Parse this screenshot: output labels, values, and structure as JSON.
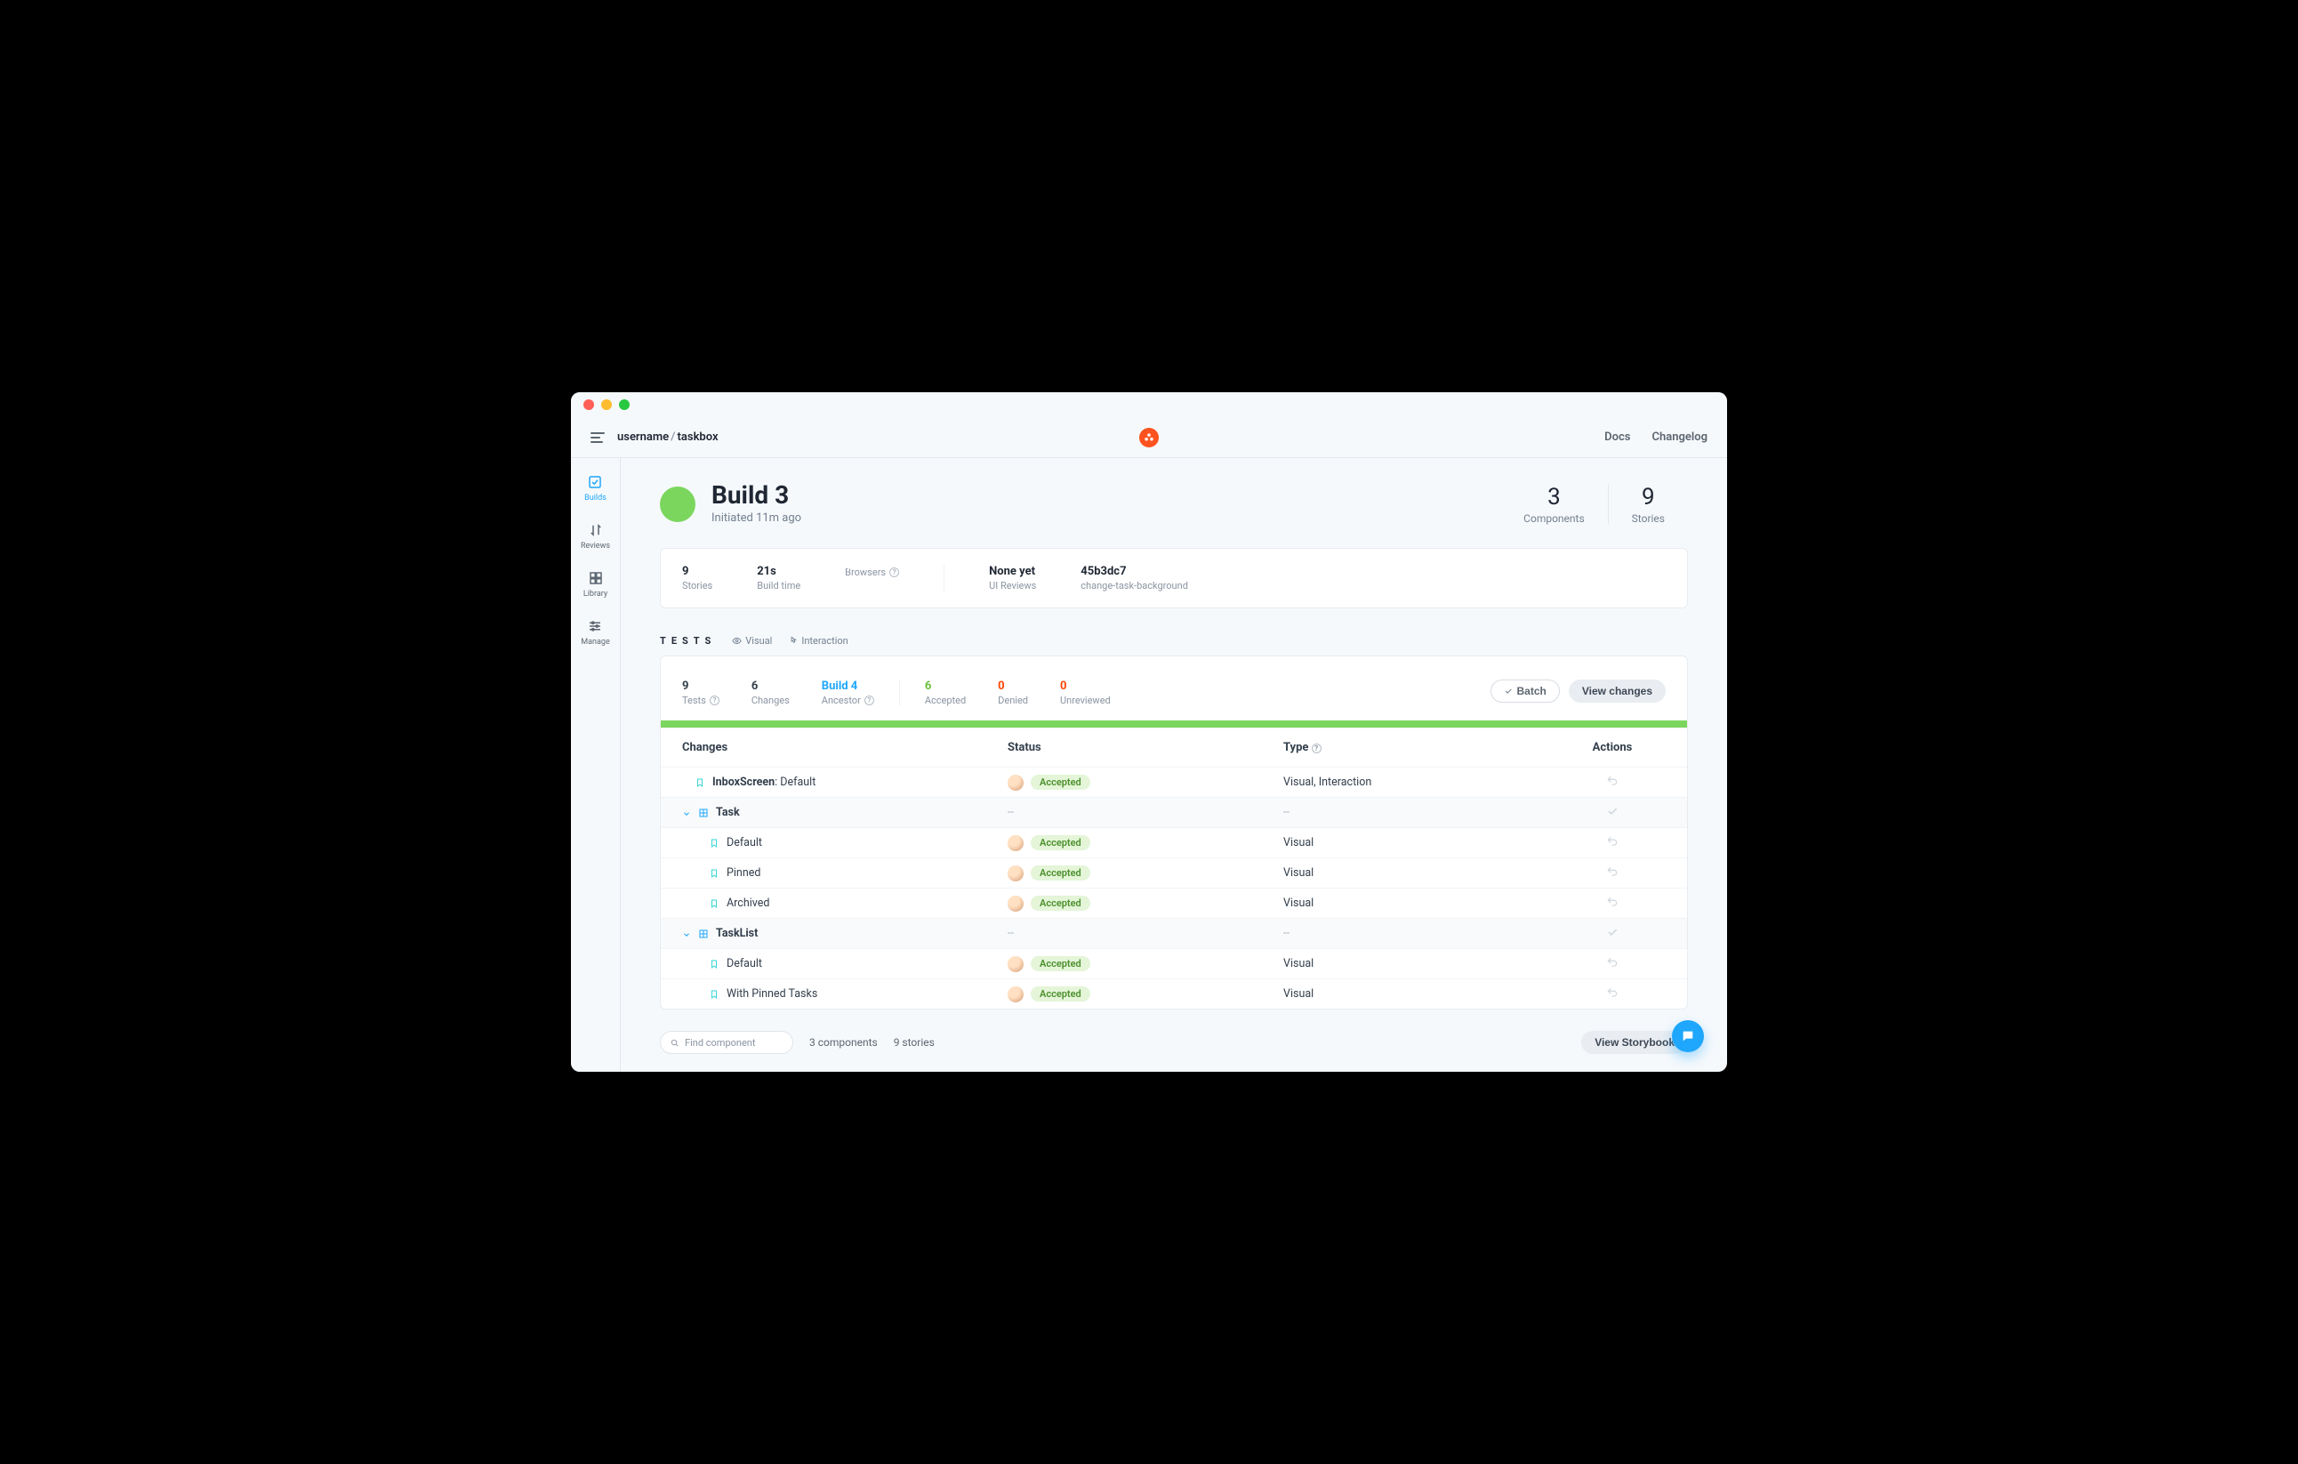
{
  "breadcrumb": {
    "owner": "username",
    "repo": "taskbox"
  },
  "top_nav": {
    "docs": "Docs",
    "changelog": "Changelog"
  },
  "sidebar": {
    "items": [
      {
        "label": "Builds"
      },
      {
        "label": "Reviews"
      },
      {
        "label": "Library"
      },
      {
        "label": "Manage"
      }
    ]
  },
  "build": {
    "title": "Build 3",
    "initiated": "Initiated 11m ago",
    "components": {
      "n": "3",
      "l": "Components"
    },
    "stories": {
      "n": "9",
      "l": "Stories"
    }
  },
  "info": {
    "stories": {
      "top": "9",
      "bot": "Stories"
    },
    "buildtime": {
      "top": "21s",
      "bot": "Build time"
    },
    "browsers": {
      "bot": "Browsers"
    },
    "uireviews": {
      "top": "None yet",
      "bot": "UI Reviews"
    },
    "commit": {
      "top": "45b3dc7",
      "bot": "change-task-background"
    }
  },
  "tests": {
    "label": "TESTS",
    "visual": "Visual",
    "interaction": "Interaction",
    "summary": {
      "tests": {
        "top": "9",
        "bot": "Tests"
      },
      "changes": {
        "top": "6",
        "bot": "Changes"
      },
      "ancestor": {
        "top": "Build 4",
        "bot": "Ancestor"
      },
      "accepted": {
        "top": "6",
        "bot": "Accepted"
      },
      "denied": {
        "top": "0",
        "bot": "Denied"
      },
      "unreviewed": {
        "top": "0",
        "bot": "Unreviewed"
      }
    },
    "batch_btn": "Batch",
    "view_changes_btn": "View changes"
  },
  "table": {
    "headers": {
      "changes": "Changes",
      "status": "Status",
      "type": "Type",
      "actions": "Actions"
    },
    "status_pill": "Accepted",
    "dash": "--",
    "rows": {
      "inbox": {
        "component": "InboxScreen",
        "story": ": Default",
        "type": "Visual, Interaction"
      },
      "task": {
        "label": "Task"
      },
      "t_default": {
        "label": "Default",
        "type": "Visual"
      },
      "t_pinned": {
        "label": "Pinned",
        "type": "Visual"
      },
      "t_arch": {
        "label": "Archived",
        "type": "Visual"
      },
      "tasklist": {
        "label": "TaskList"
      },
      "tl_default": {
        "label": "Default",
        "type": "Visual"
      },
      "tl_pinned": {
        "label": "With Pinned Tasks",
        "type": "Visual"
      }
    }
  },
  "footer": {
    "search_placeholder": "Find component",
    "components": "3 components",
    "stories": "9 stories",
    "view_storybook": "View Storybook"
  }
}
